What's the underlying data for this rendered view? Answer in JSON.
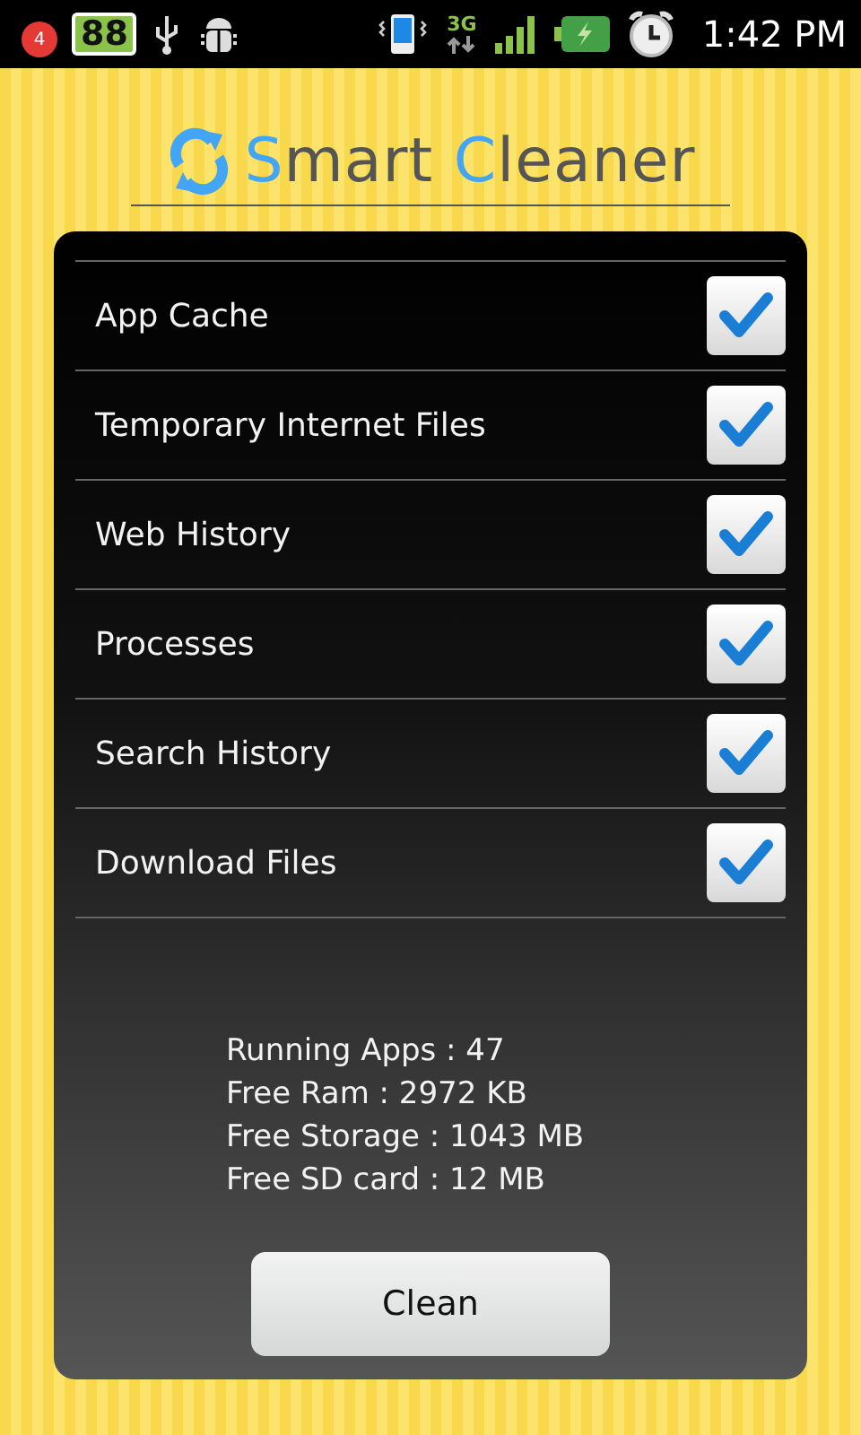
{
  "status_bar": {
    "notification_count": "4",
    "battery_level_text": "88",
    "network": "3G",
    "time": "1:42 PM"
  },
  "app_title": "Smart Cleaner",
  "items": [
    {
      "label": "App Cache",
      "checked": true
    },
    {
      "label": "Temporary Internet Files",
      "checked": true
    },
    {
      "label": "Web History",
      "checked": true
    },
    {
      "label": "Processes",
      "checked": true
    },
    {
      "label": "Search History",
      "checked": true
    },
    {
      "label": "Download Files",
      "checked": true
    }
  ],
  "stats": [
    "Running Apps : 47",
    "Free Ram : 2972 KB",
    "Free Storage : 1043 MB",
    "Free SD card : 12 MB"
  ],
  "clean_button": "Clean"
}
